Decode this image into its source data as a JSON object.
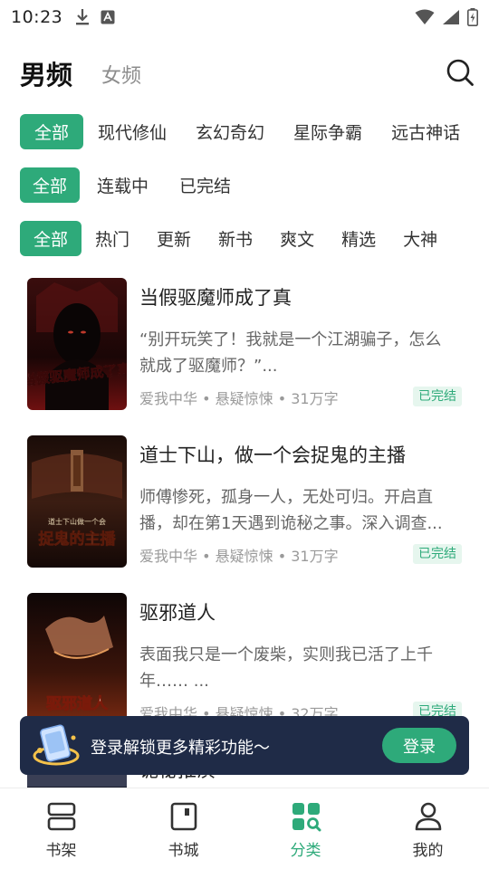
{
  "status_bar": {
    "time": "10:23",
    "icons": [
      "download-icon",
      "notification-a-icon",
      "wifi-icon",
      "cellular-signal-icon",
      "battery-charging-icon"
    ]
  },
  "header": {
    "tabs": [
      {
        "label": "男频",
        "active": true
      },
      {
        "label": "女频",
        "active": false
      }
    ],
    "search_icon": "search-icon"
  },
  "filters": {
    "category": [
      "全部",
      "现代修仙",
      "玄幻奇幻",
      "星际争霸",
      "远古神话"
    ],
    "status": [
      "全部",
      "连载中",
      "已完结"
    ],
    "sort": [
      "全部",
      "热门",
      "更新",
      "新书",
      "爽文",
      "精选",
      "大神"
    ]
  },
  "books": [
    {
      "title": "当假驱魔师成了真",
      "description": "“别开玩笑了！我就是一个江湖骗子，怎么就成了驱魔师？”...",
      "meta": "爱我中华 • 悬疑惊悚 • 31万字",
      "status": "已完结",
      "cover_text": "当假驱魔师成了真",
      "cover_colors": [
        "#2a0c0c",
        "#7a1616"
      ]
    },
    {
      "title": "道士下山，做一个会捉鬼的主播",
      "description": "师傅惨死，孤身一人，无处可归。开启直播，却在第1天遇到诡秘之事。深入调查...",
      "meta": "爱我中华 • 悬疑惊悚 • 31万字",
      "status": "已完结",
      "cover_text": "捉鬼的主播",
      "cover_colors": [
        "#1a0e0a",
        "#5a2c1c"
      ]
    },
    {
      "title": "驱邪道人",
      "description": "表面我只是一个废柴，实则我已活了上千年…… ...",
      "meta": "爱我中华 • 悬疑惊悚 • 32万字",
      "status": "已完结",
      "cover_text": "驱邪道人",
      "cover_colors": [
        "#120808",
        "#6b2414"
      ]
    },
    {
      "title": "诡秘推演",
      "description": "",
      "meta": "",
      "status": "",
      "cover_text": "",
      "cover_colors": [
        "#0e1220",
        "#3a3f55"
      ]
    }
  ],
  "login_banner": {
    "text": "登录解锁更多精彩功能～",
    "button": "登录"
  },
  "bottom_nav": [
    {
      "label": "书架",
      "icon": "bookshelf-icon",
      "active": false
    },
    {
      "label": "书城",
      "icon": "bookstore-icon",
      "active": false
    },
    {
      "label": "分类",
      "icon": "category-icon",
      "active": true
    },
    {
      "label": "我的",
      "icon": "profile-icon",
      "active": false
    }
  ],
  "colors": {
    "accent": "#2eaa7a",
    "banner_bg": "#1f2b47"
  }
}
